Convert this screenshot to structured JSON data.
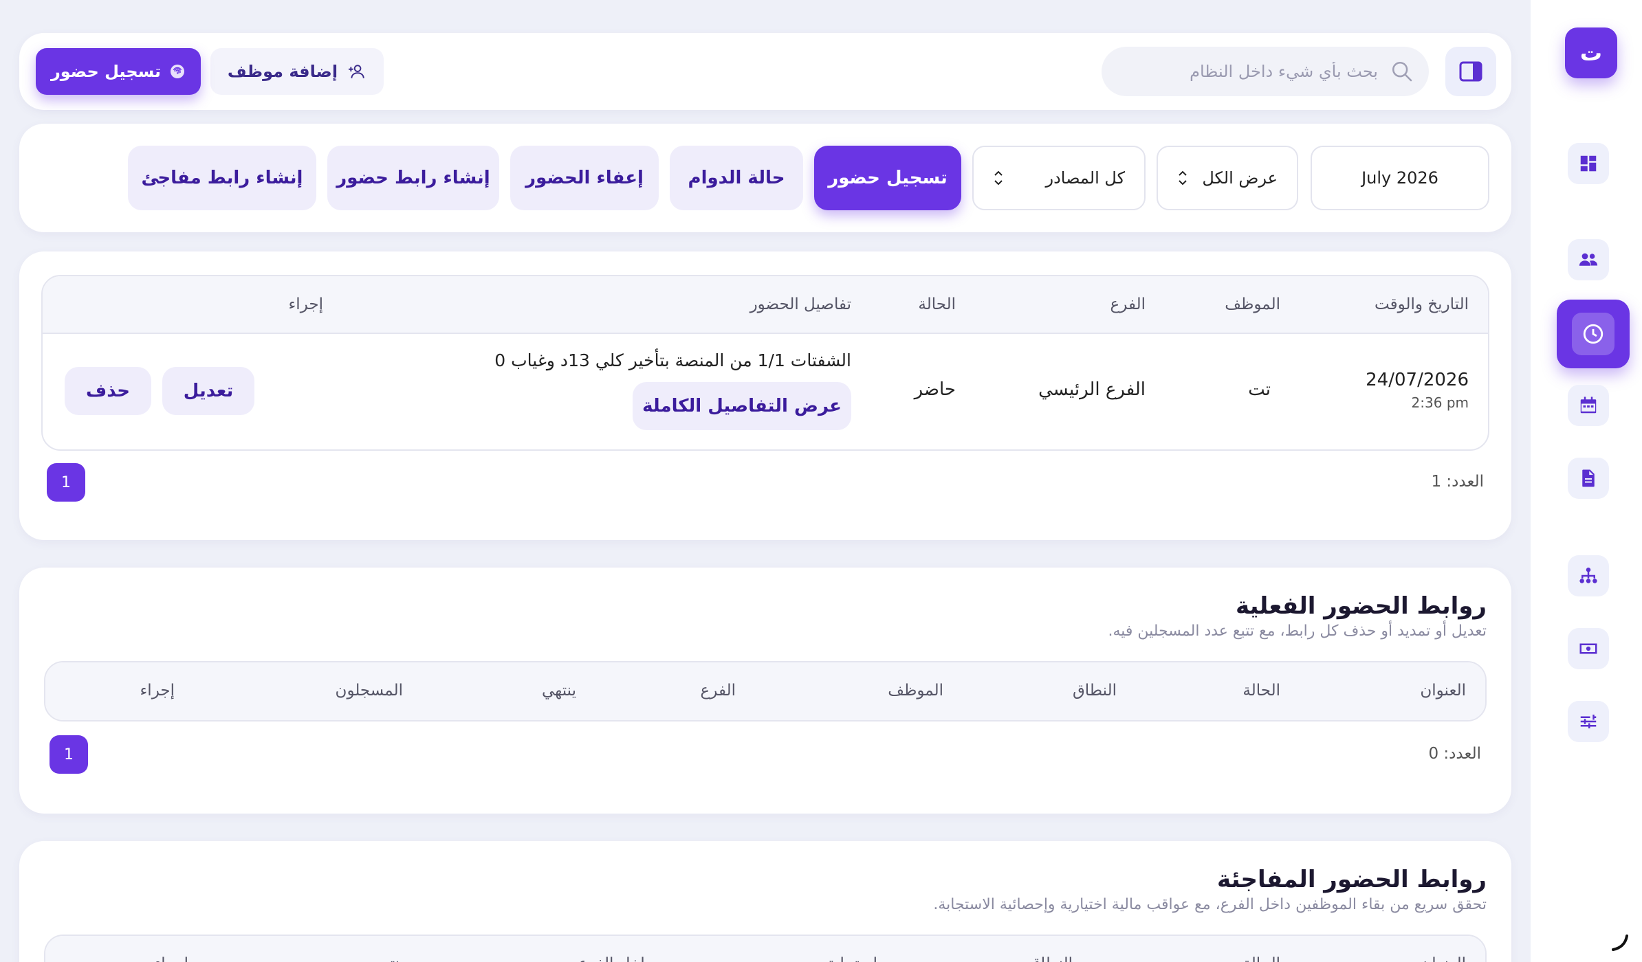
{
  "sidebar": {
    "logo_letter": "ت",
    "items": [
      {
        "icon": "dashboard-icon"
      },
      {
        "icon": "users-icon"
      },
      {
        "icon": "clock-icon",
        "active": true
      },
      {
        "icon": "calendar-icon"
      },
      {
        "icon": "document-icon"
      },
      {
        "icon": "org-chart-icon"
      },
      {
        "icon": "cash-icon"
      },
      {
        "icon": "settings-sliders-icon"
      }
    ]
  },
  "header": {
    "search_placeholder": "بحث بأي شيء داخل النظام",
    "add_employee_label": "إضافة موظف",
    "record_attendance_label": "تسجيل حضور"
  },
  "filters": {
    "date_value": "July 2026",
    "view_value": "عرض الكل",
    "source_value": "كل المصادر",
    "buttons": {
      "record_attendance": "تسجيل حضور",
      "shift_status": "حالة الدوام",
      "attendance_exemption": "إعفاء الحضور",
      "create_attendance_link": "إنشاء رابط حضور",
      "create_surprise_link": "إنشاء رابط مفاجئ"
    }
  },
  "attendance_table": {
    "columns": {
      "datetime": "التاريخ والوقت",
      "employee": "الموظف",
      "branch": "الفرع",
      "status": "الحالة",
      "details": "تفاصيل الحضور",
      "action": "إجراء"
    },
    "rows": [
      {
        "date": "24/07/2026",
        "time": "2:36 pm",
        "employee": "تت",
        "branch": "الفرع الرئيسي",
        "status": "حاضر",
        "details": "الشفتات 1/1 من المنصة بتأخير كلي 13د وغياب 0",
        "details_button": "عرض التفاصيل الكاملة",
        "edit_label": "تعديل",
        "delete_label": "حذف"
      }
    ],
    "count_label": "العدد: 1",
    "page": "1"
  },
  "active_links": {
    "title": "روابط الحضور الفعلية",
    "subtitle": "تعديل أو تمديد أو حذف كل رابط، مع تتبع عدد المسجلين فيه.",
    "columns": {
      "title": "العنوان",
      "status": "الحالة",
      "scope": "النطاق",
      "employee": "الموظف",
      "branch": "الفرع",
      "ends": "ينتهي",
      "registered": "المسجلون",
      "action": "إجراء"
    },
    "count_label": "العدد: 0",
    "page": "1"
  },
  "surprise_links": {
    "title": "روابط الحضور المفاجئة",
    "subtitle": "تحقق سريع من بقاء الموظفين داخل الفرع، مع عواقب مالية اختيارية وإحصائية الاستجابة.",
    "columns": {
      "title": "العنوان",
      "status": "الحالة",
      "scope": "النطاق",
      "response": "استجابة",
      "inside_branch": "داخل الفرع",
      "ends": "ينتهي",
      "action": "إجراء"
    }
  },
  "colors": {
    "accent": "#6a35e4",
    "accent_soft": "#efedfb",
    "background": "#eef0f8"
  }
}
